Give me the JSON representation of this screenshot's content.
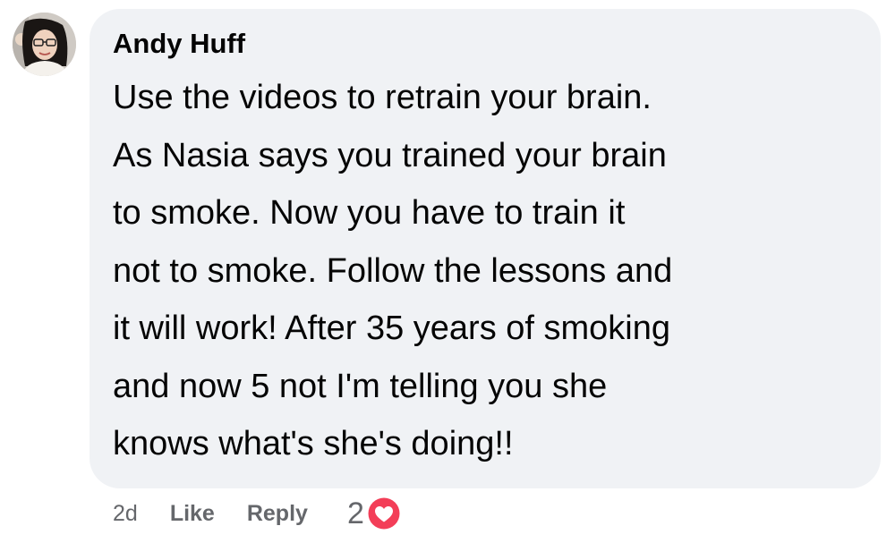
{
  "comment": {
    "author": "Andy Huff",
    "body": "Use the videos to retrain your brain.\nAs Nasia says you trained your brain\nto smoke. Now you have to train it\nnot to smoke. Follow the lessons and\nit will work! After 35 years of smoking\nand now 5 not I'm telling you she\nknows what's she's doing!!",
    "avatar_icon": "profile-photo"
  },
  "actions": {
    "timestamp": "2d",
    "like_label": "Like",
    "reply_label": "Reply",
    "reaction_count": "2",
    "reaction_icon": "heart-icon"
  },
  "colors": {
    "bubble_bg": "#f0f2f5",
    "meta_text": "#65676b",
    "heart_red": "#f33e58"
  }
}
